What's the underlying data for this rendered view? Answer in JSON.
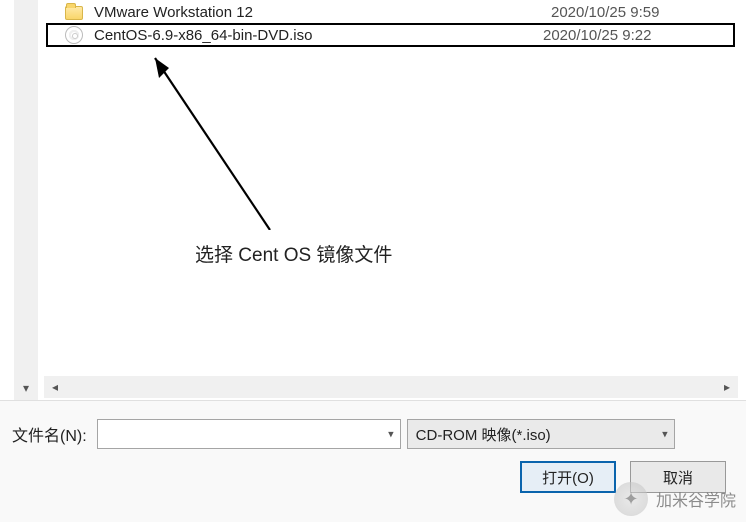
{
  "files": [
    {
      "name": "VMware Workstation 12",
      "date": "2020/10/25 9:59",
      "type": "folder"
    },
    {
      "name": "CentOS-6.9-x86_64-bin-DVD.iso",
      "date": "2020/10/25 9:22",
      "type": "iso",
      "selected": true
    }
  ],
  "annotation": {
    "text": "选择 Cent OS 镜像文件"
  },
  "footer": {
    "filename_label": "文件名(N):",
    "filename_value": "",
    "filetype_label": "CD-ROM 映像(*.iso)",
    "open_button": "打开(O)",
    "cancel_button": "取消"
  },
  "watermark": {
    "text": "加米谷学院"
  }
}
